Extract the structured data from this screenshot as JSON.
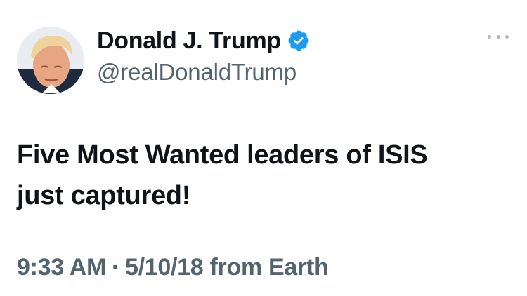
{
  "author": {
    "display_name": "Donald J. Trump",
    "handle": "@realDonaldTrump",
    "verified_badge_color": "#1d9bf0"
  },
  "tweet": {
    "text": "Five Most Wanted leaders of ISIS\njust captured!"
  },
  "meta": {
    "time": "9:33 AM",
    "separator": "·",
    "date_source": "5/10/18 from Earth"
  },
  "icons": {
    "more": "more-options-icon",
    "verified": "verified-badge-icon"
  }
}
